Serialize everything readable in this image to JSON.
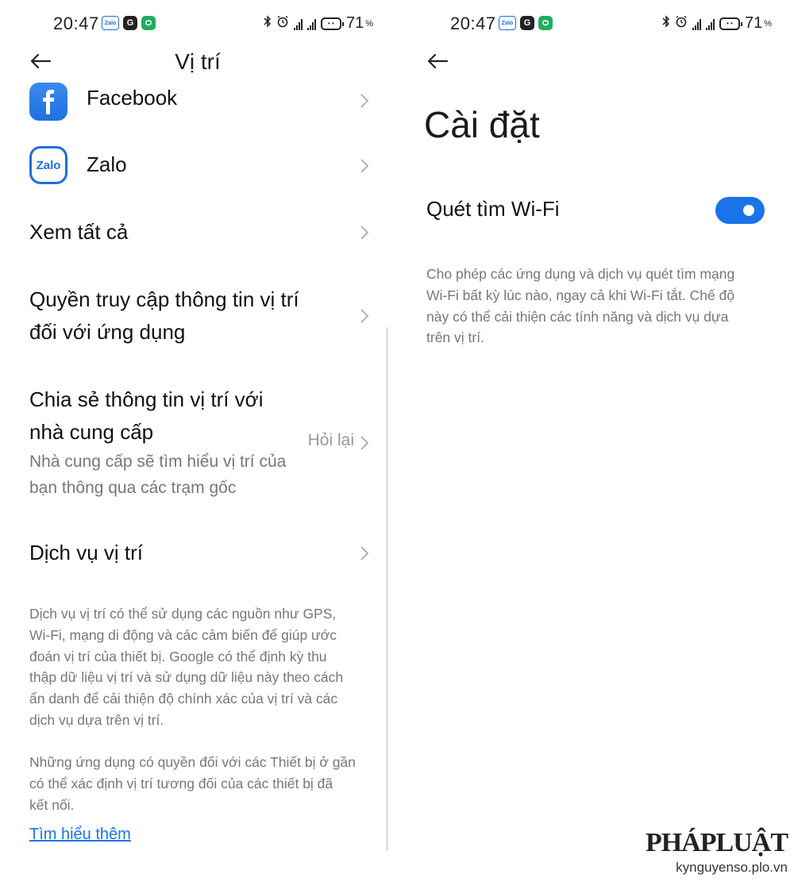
{
  "status_bar": {
    "time": "20:47",
    "battery_level": "71",
    "battery_unit": "%",
    "notification_icons": [
      "zalo-icon",
      "g-app-icon",
      "shield-app-icon"
    ],
    "system_icons": [
      "bluetooth-icon",
      "alarm-icon",
      "signal-icon",
      "signal-icon",
      "battery-icon"
    ],
    "zalo_mini": "Zalo",
    "g_mini": "G"
  },
  "left": {
    "title": "Vị trí",
    "apps": [
      {
        "label": "Facebook",
        "icon": "facebook-icon"
      },
      {
        "label": "Zalo",
        "icon": "zalo-icon",
        "icon_text": "Zalo"
      }
    ],
    "see_all": "Xem tất cả",
    "app_permission": {
      "line1": "Quyền truy cập thông tin vị trí",
      "line2": "đối với ứng dụng"
    },
    "carrier_share": {
      "line1": "Chia sẻ thông tin vị trí với",
      "line2": "nhà cung cấp",
      "value": "Hỏi lại",
      "sub1": "Nhà cung cấp sẽ tìm hiểu vị trí của",
      "sub2": "bạn thông qua các trạm gốc"
    },
    "location_services": "Dịch vụ vị trí",
    "desc1": [
      "Dịch vụ vị trí có thể sử dụng các nguồn như GPS,",
      "Wi-Fi, mạng di động và các cảm biến để giúp ước",
      "đoán vị trí của thiết bị. Google có thể định kỳ thu",
      "thập dữ liệu vị trí và sử dụng dữ liệu này theo cách",
      "ẩn danh để cải thiện độ chính xác của vị trí và các",
      "dịch vụ dựa trên vị trí."
    ],
    "desc2": [
      "Những ứng dụng có quyền đối với các Thiết bị ở gần",
      "có thể xác định vị trí tương đối của các thiết bị đã",
      "kết nối."
    ],
    "learn_more": "Tìm hiểu thêm"
  },
  "right": {
    "title": "Cài đặt",
    "wifi_scan_label": "Quét tìm Wi-Fi",
    "wifi_scan_enabled": true,
    "wifi_desc": [
      "Cho phép các ứng dụng và dịch vụ quét tìm mạng",
      "Wi-Fi bất kỳ lúc nào, ngay cả khi Wi-Fi tắt. Chế độ",
      "này có thể cải thiện các tính năng và dịch vụ dựa",
      "trên vị trí."
    ]
  },
  "watermark": {
    "logo": "PHÁPLUẬT",
    "url": "kynguyenso.plo.vn"
  },
  "colors": {
    "accent": "#1a73e8",
    "facebook": "#1f6fe0",
    "zalo": "#1a6fe0"
  }
}
